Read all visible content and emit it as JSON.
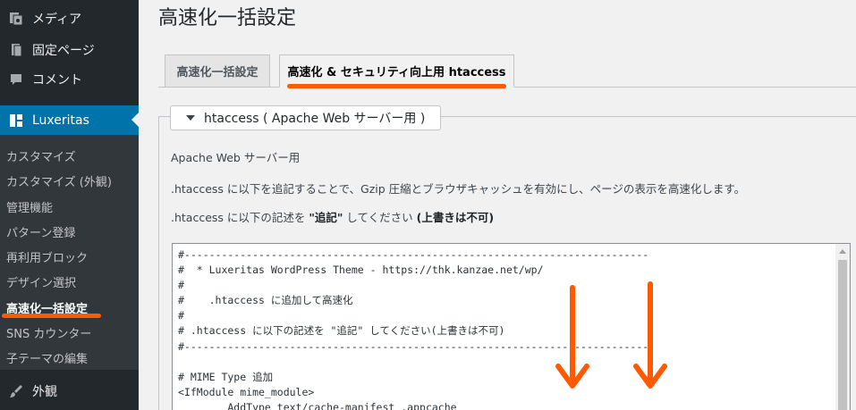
{
  "sidebar": {
    "top_items": [
      {
        "label": "メディア",
        "icon": "media-icon"
      },
      {
        "label": "固定ページ",
        "icon": "page-icon"
      },
      {
        "label": "コメント",
        "icon": "comment-icon"
      }
    ],
    "active": {
      "label": "Luxeritas",
      "icon": "luxeritas-icon"
    },
    "submenu": [
      "カスタマイズ",
      "カスタマイズ (外観)",
      "管理機能",
      "パターン登録",
      "再利用ブロック",
      "デザイン選択",
      "高速化一括設定",
      "SNS カウンター",
      "子テーマの編集"
    ],
    "current_submenu": "高速化一括設定",
    "bottom_item": {
      "label": "外観",
      "icon": "brush-icon"
    }
  },
  "main": {
    "title": "高速化一括設定",
    "tabs": [
      {
        "label": "高速化一括設定",
        "active": false
      },
      {
        "label": "高速化 & セキュリティ向上用 htaccess",
        "active": true
      }
    ],
    "section_toggle": "htaccess ( Apache Web サーバー用 )",
    "paragraphs": {
      "p1": "Apache Web サーバー用",
      "p2": ".htaccess に以下を追記することで、Gzip 圧縮とブラウザキャッシュを有効にし、ページの表示を高速化します。",
      "p3_prefix": ".htaccess に以下の記述を ",
      "p3_bold1": "\"追記\"",
      "p3_mid": " してください ",
      "p3_bold2": "(上書きは不可)"
    },
    "code_lines": [
      "#---------------------------------------------------------------------------",
      "#  * Luxeritas WordPress Theme - https://thk.kanzae.net/wp/",
      "#",
      "#    .htaccess に追加して高速化",
      "#",
      "# .htaccess に以下の記述を \"追記\" してください(上書きは不可)",
      "#---------------------------------------------------------------------------",
      "",
      "# MIME Type 追加",
      "<IfModule mime_module>",
      "        AddType text/cache-manifest .appcache"
    ]
  },
  "colors": {
    "sidebar_bg": "#23282d",
    "submenu_bg": "#32373c",
    "active_bg": "#0073aa",
    "annotation": "#ff5a00"
  }
}
